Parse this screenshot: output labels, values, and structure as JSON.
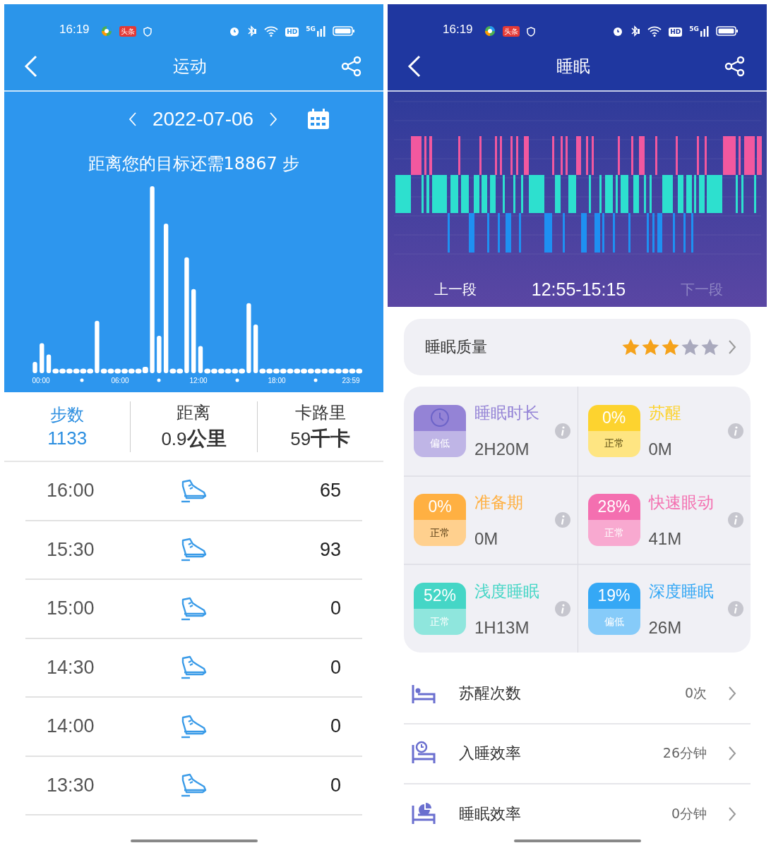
{
  "steps_screen": {
    "status_bar": {
      "time": "16:19",
      "news_badge": "头条",
      "hd": "HD",
      "network": "5G"
    },
    "header": {
      "title": "运动"
    },
    "date": "2022-07-06",
    "goal": "距离您的目标还需18867 步",
    "axis_labels": [
      "00:00",
      "06:00",
      "12:00",
      "18:00",
      "23:59"
    ],
    "stats": [
      {
        "label": "步数",
        "value": "1133",
        "selected": true
      },
      {
        "label": "距离",
        "value": "0.9",
        "unit": "公里",
        "selected": false
      },
      {
        "label": "卡路里",
        "value": "59",
        "unit": "千卡",
        "selected": false
      }
    ],
    "records": [
      {
        "time": "16:00",
        "steps": "65"
      },
      {
        "time": "15:30",
        "steps": "93"
      },
      {
        "time": "15:00",
        "steps": "0"
      },
      {
        "time": "14:30",
        "steps": "0"
      },
      {
        "time": "14:00",
        "steps": "0"
      },
      {
        "time": "13:30",
        "steps": "0"
      }
    ]
  },
  "sleep_screen": {
    "status_bar": {
      "time": "16:19",
      "news_badge": "头条",
      "hd": "HD",
      "network": "5G"
    },
    "header": {
      "title": "睡眠"
    },
    "segment_nav": {
      "prev": {
        "label": "上一段",
        "disabled": false
      },
      "range": "12:55-15:15",
      "next": {
        "label": "下一段",
        "disabled": true
      }
    },
    "quality": {
      "label": "睡眠质量",
      "stars": 3
    },
    "stages": [
      {
        "kind": "duration",
        "name": "睡眠时长",
        "status": "偏低",
        "value": "2H20M",
        "color": "#9483d6"
      },
      {
        "kind": "percent",
        "name": "苏醒",
        "percent": "0%",
        "status": "正常",
        "value": "0M",
        "color": "#fdd32f"
      },
      {
        "kind": "percent",
        "name": "准备期",
        "percent": "0%",
        "status": "正常",
        "value": "0M",
        "color": "#ffb042"
      },
      {
        "kind": "percent",
        "name": "快速眼动",
        "percent": "28%",
        "status": "正常",
        "value": "41M",
        "color": "#f46fb0"
      },
      {
        "kind": "percent",
        "name": "浅度睡眠",
        "percent": "52%",
        "status": "正常",
        "value": "1H13M",
        "color": "#45d6c6"
      },
      {
        "kind": "percent",
        "name": "深度睡眠",
        "percent": "19%",
        "status": "偏低",
        "value": "26M",
        "color": "#35a8f5"
      }
    ],
    "metrics": [
      {
        "kind": "bed",
        "label": "苏醒次数",
        "value": "0次"
      },
      {
        "kind": "bed-clock",
        "label": "入睡效率",
        "value": "26分钟"
      },
      {
        "kind": "bed-pie",
        "label": "睡眠效率",
        "value": "0分钟"
      }
    ]
  }
}
